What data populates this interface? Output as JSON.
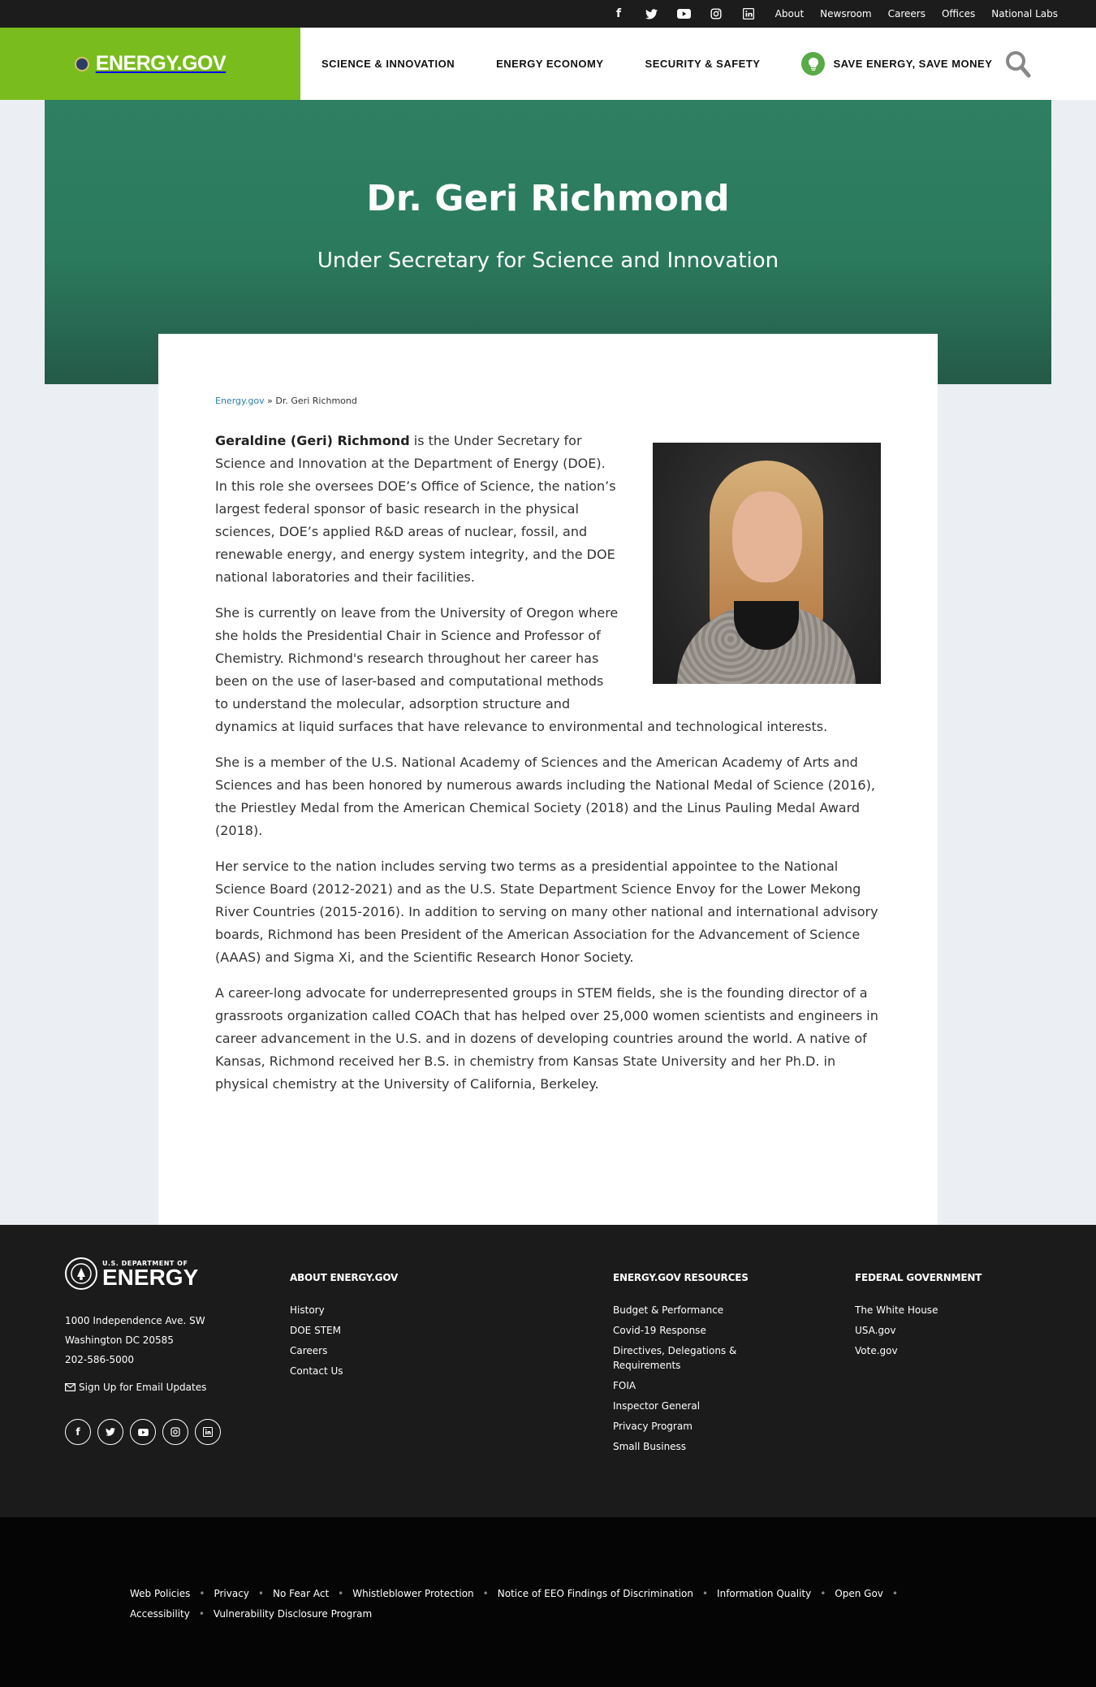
{
  "topbar": {
    "social_icons": [
      "facebook-icon",
      "twitter-icon",
      "youtube-icon",
      "instagram-icon",
      "linkedin-icon"
    ],
    "social_glyphs": [
      "f",
      "t",
      "▶",
      "◎",
      "in"
    ],
    "links": [
      "About",
      "Newsroom",
      "Careers",
      "Offices",
      "National Labs"
    ]
  },
  "header": {
    "logo": "ENERGY.GOV",
    "nav": [
      "SCIENCE & INNOVATION",
      "ENERGY ECONOMY",
      "SECURITY & SAFETY"
    ],
    "save_energy": "SAVE ENERGY, SAVE MONEY",
    "brand_color": "#79bc1d"
  },
  "hero": {
    "title": "Dr. Geri Richmond",
    "subtitle": "Under Secretary for Science and Innovation",
    "color": "#2b7a5e"
  },
  "breadcrumb": {
    "home": "Energy.gov",
    "separator": "»",
    "current": "Dr. Geri Richmond"
  },
  "bio": {
    "name": "Geraldine (Geri) Richmond",
    "p1": " is the Under Secretary for Science and Innovation at the Department of Energy (DOE). In this role she oversees DOE’s Office of Science, the nation’s largest federal sponsor of basic research in the physical sciences, DOE’s applied R&D areas of nuclear, fossil, and renewable energy, and energy system integrity, and the DOE national laboratories and their facilities.",
    "p2": "She is currently on leave from the University of Oregon where she holds the Presidential Chair in Science and Professor of Chemistry. Richmond's research throughout her career has been on the use of laser-based and computational methods to understand the molecular, adsorption structure and dynamics at liquid surfaces that have relevance to environmental and technological interests.",
    "p3": "She is a member of the U.S. National Academy of Sciences and the American Academy of Arts and Sciences and has been honored by numerous awards including the National Medal of Science (2016), the Priestley Medal from the American Chemical Society (2018) and the Linus Pauling Medal Award (2018).",
    "p4": "Her service to the nation includes serving two terms as a presidential appointee to the National Science Board (2012-2021) and as the U.S. State Department Science Envoy for the Lower Mekong River Countries (2015-2016). In addition to serving on many other national and international advisory boards, Richmond has been President of the American Association for the Advancement of Science (AAAS) and Sigma Xi, and the Scientific Research Honor Society.",
    "p5": "A career-long advocate for underrepresented groups in STEM fields,  she is the founding director of a grassroots organization called COACh that has helped over 25,000 women scientists and engineers in career advancement in the U.S. and in dozens of developing countries around the world. A native of Kansas, Richmond received her B.S. in chemistry from Kansas State University and her Ph.D. in physical chemistry at the University of California, Berkeley."
  },
  "footer": {
    "brand_small": "U.S. DEPARTMENT OF",
    "brand_big": "ENERGY",
    "address": [
      "1000 Independence Ave. SW",
      "Washington DC 20585",
      "202-586-5000"
    ],
    "email_updates": "Sign Up for Email Updates",
    "columns": [
      {
        "title": "ABOUT ENERGY.GOV",
        "links": [
          "History",
          "DOE STEM",
          "Careers",
          "Contact Us"
        ]
      },
      {
        "title": "ENERGY.GOV RESOURCES",
        "links": [
          "Budget & Performance",
          "Covid-19 Response",
          "Directives, Delegations & Requirements",
          "FOIA",
          "Inspector General",
          "Privacy Program",
          "Small Business"
        ]
      },
      {
        "title": "FEDERAL GOVERNMENT",
        "links": [
          "The White House",
          "USA.gov",
          "Vote.gov"
        ]
      }
    ]
  },
  "legal_links": [
    "Web Policies",
    "Privacy",
    "No Fear Act",
    "Whistleblower Protection",
    "Notice of EEO Findings of Discrimination",
    "Information Quality",
    "Open Gov",
    "Accessibility",
    "Vulnerability Disclosure Program"
  ]
}
